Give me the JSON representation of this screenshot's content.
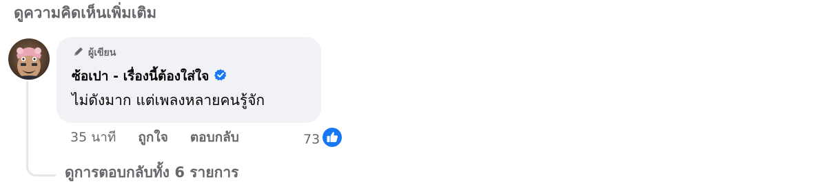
{
  "header": {
    "more_comments_label": "ดูความคิดเห็นเพิ่มเติม"
  },
  "comment": {
    "author_badge_label": "ผู้เขียน",
    "author_name": "ซ้อเปา - เรื่องนี้ต้องใส่ใจ",
    "text": "ไม่ดังมาก แต่เพลงหลายคนรู้จัก",
    "time": "35 นาที",
    "like_label": "ถูกใจ",
    "reply_label": "ตอบกลับ",
    "reaction_count": "73",
    "reaction_icon": "like-icon",
    "verified_icon": "verified-badge-icon",
    "badge_icon": "pencil-icon",
    "colors": {
      "bubble": "#f0f2f5",
      "muted_text": "#65676b",
      "verified_blue": "#1877f2",
      "like_blue": "#1877f2"
    }
  },
  "replies": {
    "view_all_label": "ดูการตอบกลับทั้ง 6 รายการ"
  }
}
